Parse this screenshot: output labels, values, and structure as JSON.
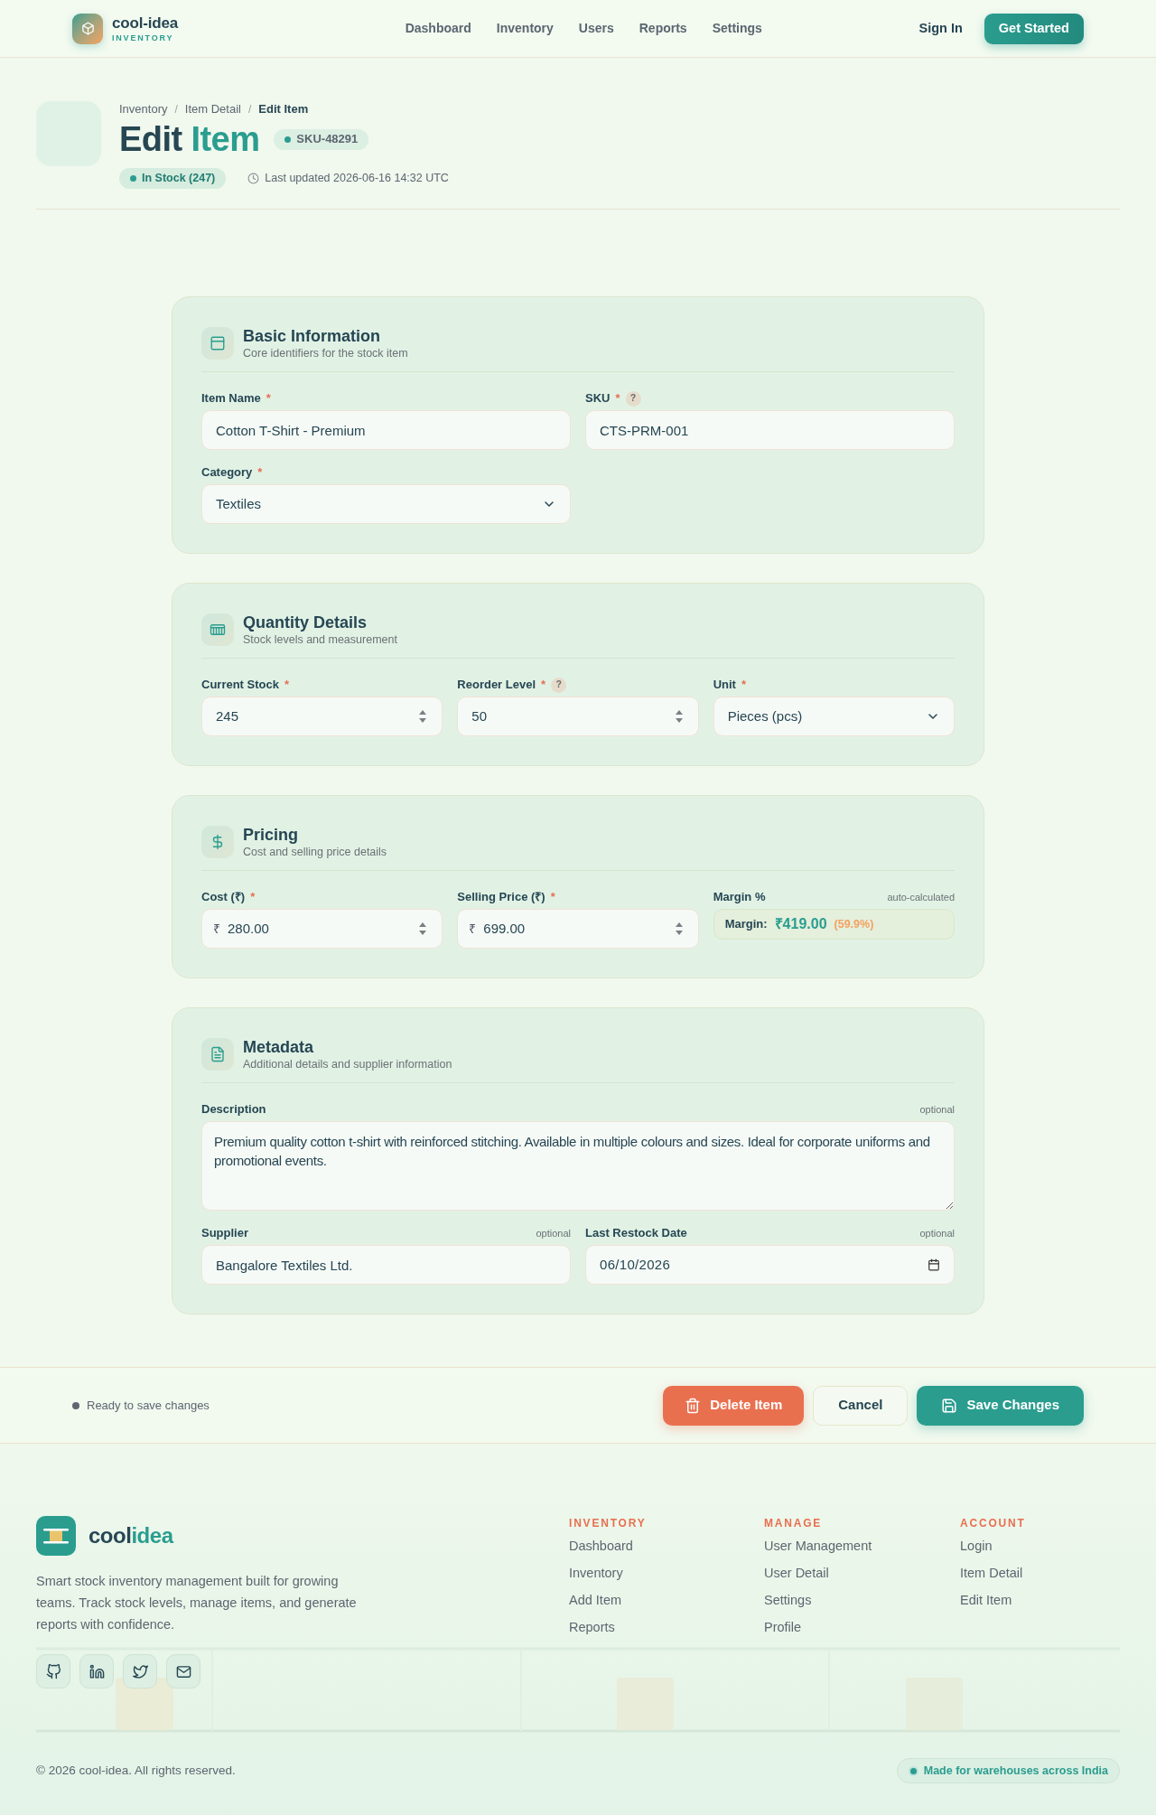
{
  "nav": {
    "brand": "cool-idea",
    "brand_sub": "INVENTORY",
    "links": [
      "Dashboard",
      "Inventory",
      "Users",
      "Reports",
      "Settings"
    ],
    "sign_in": "Sign In",
    "cta": "Get Started"
  },
  "header": {
    "breadcrumb": [
      {
        "label": "Inventory",
        "current": false,
        "separator": "/"
      },
      {
        "label": "Item Detail",
        "current": false,
        "separator": "/"
      },
      {
        "label": "Edit Item",
        "current": true
      }
    ],
    "title": {
      "text": "Edit",
      "accent": "Item"
    },
    "sku": "SKU-48291",
    "stock": "In Stock (247)",
    "updated": "Last updated 2026-06-16 14:32 UTC"
  },
  "sections": [
    {
      "kind": "identity",
      "title": "Basic Information",
      "subtitle": "Core identifiers for the stock item",
      "fields": [
        {
          "kind": "text",
          "label": "Item Name",
          "mark": "*",
          "value": "Cotton T-Shirt - Premium"
        },
        {
          "kind": "text",
          "label": "SKU",
          "mark": "*",
          "help": "?",
          "value": "CTS-PRM-001"
        },
        {
          "kind": "select",
          "label": "Category",
          "mark": "*",
          "value": "Textiles"
        }
      ]
    },
    {
      "kind": "quantity",
      "title": "Quantity Details",
      "subtitle": "Stock levels and measurement",
      "fields": [
        {
          "kind": "number",
          "label": "Current Stock",
          "mark": "*",
          "value": "245"
        },
        {
          "kind": "number",
          "label": "Reorder Level",
          "mark": "*",
          "help": "?",
          "value": "50"
        },
        {
          "kind": "select",
          "label": "Unit",
          "mark": "*",
          "value": "Pieces (pcs)"
        }
      ]
    },
    {
      "kind": "pricing",
      "title": "Pricing",
      "subtitle": "Cost and selling price details",
      "fields": [
        {
          "kind": "number",
          "label": "Cost (₹)",
          "mark": "*",
          "prefix": "₹",
          "value": "280.00"
        },
        {
          "kind": "number",
          "label": "Selling Price (₹)",
          "mark": "*",
          "prefix": "₹",
          "value": "699.00"
        },
        {
          "kind": "margin",
          "label": "Margin %",
          "note": "auto-calculated",
          "caption": "Margin:",
          "amount": "₹419.00",
          "percent": "(59.9%)"
        }
      ]
    },
    {
      "kind": "metadata",
      "title": "Metadata",
      "subtitle": "Additional details and supplier information",
      "fields": [
        {
          "kind": "textarea",
          "label": "Description",
          "note": "optional",
          "value": "Premium quality cotton t-shirt with reinforced stitching. Available in multiple colours and sizes. Ideal for corporate uniforms and promotional events."
        },
        {
          "kind": "text",
          "label": "Supplier",
          "note": "optional",
          "value": "Bangalore Textiles Ltd."
        },
        {
          "kind": "date",
          "label": "Last Restock Date",
          "note": "optional",
          "value": "06/10/2026"
        }
      ]
    }
  ],
  "actions": {
    "status": "Ready to save changes",
    "buttons": [
      {
        "kind": "danger",
        "label": "Delete Item"
      },
      {
        "kind": "secondary",
        "label": "Cancel"
      },
      {
        "kind": "primary",
        "label": "Save Changes"
      }
    ]
  },
  "footer": {
    "brand": {
      "text": "cool",
      "accent": "idea"
    },
    "description": "Smart stock inventory management built for growing teams. Track stock levels, manage items, and generate reports with confidence.",
    "columns": [
      {
        "heading": "INVENTORY",
        "links": [
          "Dashboard",
          "Inventory",
          "Add Item",
          "Reports"
        ]
      },
      {
        "heading": "MANAGE",
        "links": [
          "User Management",
          "User Detail",
          "Settings",
          "Profile"
        ]
      },
      {
        "heading": "ACCOUNT",
        "links": [
          "Login",
          "Item Detail",
          "Edit Item"
        ]
      }
    ],
    "copyright": "© 2026 cool-idea. All rights reserved.",
    "badge": "Made for warehouses across India"
  }
}
